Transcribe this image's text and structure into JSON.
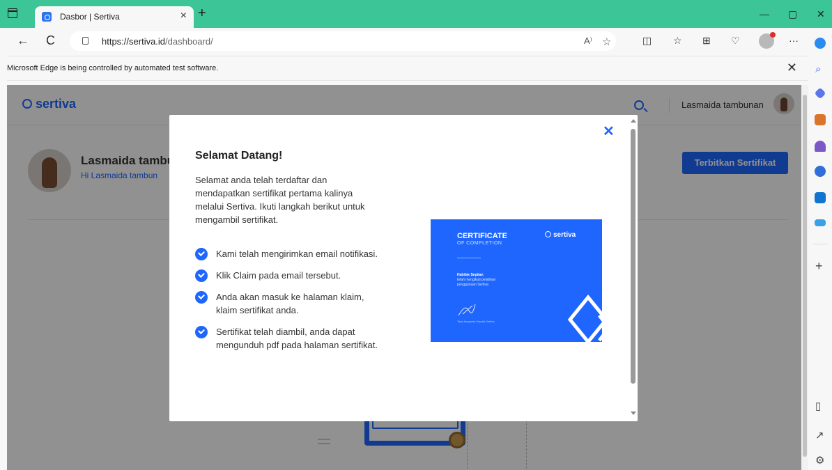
{
  "browser": {
    "tab_title": "Dasbor | Sertiva",
    "tab_close": "×",
    "new_tab": "+",
    "minimize": "—",
    "restore": "▢",
    "close": "✕",
    "back": "←",
    "refresh": "C",
    "url_host": "https://sertiva.id",
    "url_path": "/dashboard/",
    "read_aloud": "A⁾",
    "infobar_text": "Microsoft Edge is being controlled by automated test software.",
    "infobar_close": "✕",
    "more": "···"
  },
  "header": {
    "logo_text": "sertiva",
    "user_name": "Lasmaida tambunan"
  },
  "profile": {
    "name": "Lasmaida tambu",
    "greeting": "Hi Lasmaida tambun",
    "publish_button": "Terbitkan Sertifikat"
  },
  "modal": {
    "close": "✕",
    "title": "Selamat Datang!",
    "description": "Selamat anda telah terdaftar dan mendapatkan sertifikat pertama kalinya melalui Sertiva. Ikuti langkah berikut untuk mengambil sertifikat.",
    "steps": [
      "Kami telah mengirimkan email notifikasi.",
      "Klik Claim pada email tersebut.",
      "Anda akan masuk ke halaman klaim, klaim sertifikat anda.",
      "Sertifikat telah diambil, anda dapat mengunduh pdf pada halaman sertifikat."
    ],
    "certificate": {
      "title": "CERTIFICATE",
      "subtitle": "OF COMPLETION",
      "logo": "sertiva",
      "holder": "Habibie Septian",
      "text": "telah mengikuti pelatihan penggunaan Sertiva",
      "signer": "Tapa tanganan\nKepala Sertiva"
    }
  },
  "colors": {
    "brand_blue": "#1f66ff",
    "titlebar_green": "#3cc596"
  }
}
